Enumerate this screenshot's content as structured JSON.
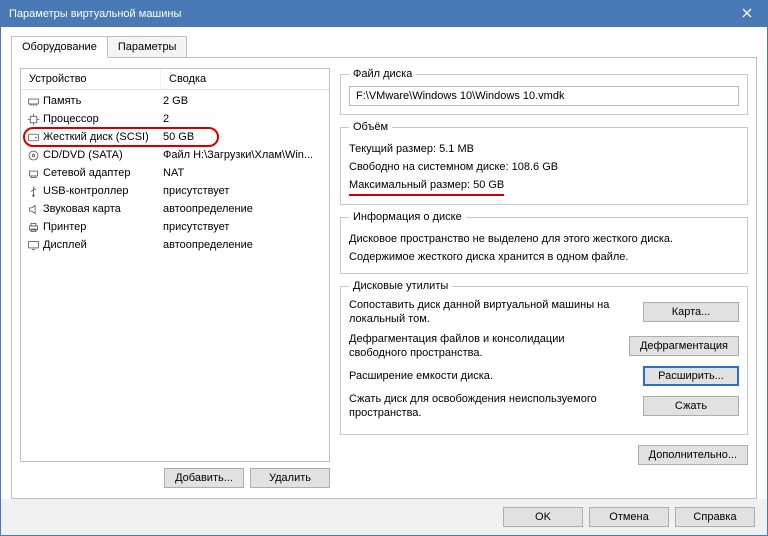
{
  "window": {
    "title": "Параметры виртуальной машины"
  },
  "tabs": {
    "hardware": "Оборудование",
    "options": "Параметры"
  },
  "headers": {
    "device": "Устройство",
    "summary": "Сводка"
  },
  "devices": [
    {
      "icon": "memory",
      "name": "Память",
      "summary": "2 GB"
    },
    {
      "icon": "cpu",
      "name": "Процессор",
      "summary": "2"
    },
    {
      "icon": "hdd",
      "name": "Жесткий диск (SCSI)",
      "summary": "50 GB",
      "selected": true
    },
    {
      "icon": "cd",
      "name": "CD/DVD (SATA)",
      "summary": "Файл H:\\Загрузки\\Хлам\\Win..."
    },
    {
      "icon": "net",
      "name": "Сетевой адаптер",
      "summary": "NAT"
    },
    {
      "icon": "usb",
      "name": "USB-контроллер",
      "summary": "присутствует"
    },
    {
      "icon": "sound",
      "name": "Звуковая карта",
      "summary": "автоопределение"
    },
    {
      "icon": "printer",
      "name": "Принтер",
      "summary": "присутствует"
    },
    {
      "icon": "display",
      "name": "Дисплей",
      "summary": "автоопределение"
    }
  ],
  "leftButtons": {
    "add": "Добавить...",
    "remove": "Удалить"
  },
  "diskFile": {
    "legend": "Файл диска",
    "value": "F:\\VMware\\Windows 10\\Windows 10.vmdk"
  },
  "capacity": {
    "legend": "Объём",
    "current": "Текущий размер: 5.1 MB",
    "free": "Свободно на системном диске: 108.6 GB",
    "max_label": "Максимальный размер:",
    "max_value": "50 GB"
  },
  "diskInfo": {
    "legend": "Информация о диске",
    "line1": "Дисковое пространство не выделено для этого жесткого диска.",
    "line2": "Содержимое жесткого диска хранится в одном файле."
  },
  "utilities": {
    "legend": "Дисковые утилиты",
    "map_text": "Сопоставить диск данной виртуальной машины на локальный том.",
    "map_btn": "Карта...",
    "defrag_text": "Дефрагментация файлов и консолидации свободного пространства.",
    "defrag_btn": "Дефрагментация",
    "expand_text": "Расширение емкости диска.",
    "expand_btn": "Расширить...",
    "compact_text": "Сжать диск для освобождения неиспользуемого пространства.",
    "compact_btn": "Сжать"
  },
  "advanced": "Дополнительно...",
  "dialog": {
    "ok": "OK",
    "cancel": "Отмена",
    "help": "Справка"
  }
}
